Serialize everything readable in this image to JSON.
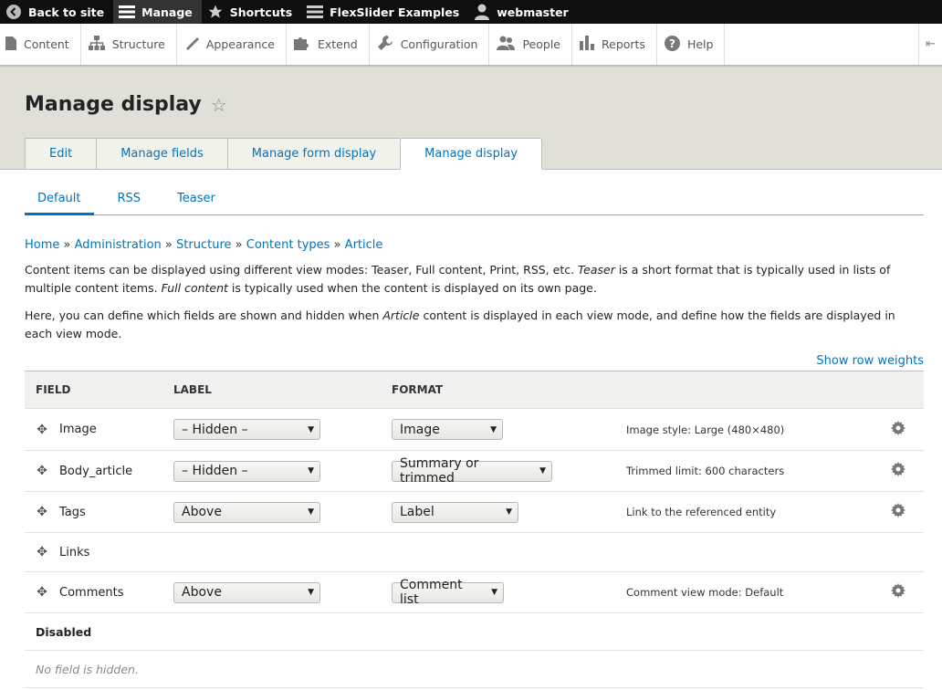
{
  "toolbar": {
    "back": "Back to site",
    "manage": "Manage",
    "shortcuts": "Shortcuts",
    "flexslider": "FlexSlider Examples",
    "user": "webmaster"
  },
  "tray": {
    "items": [
      "Content",
      "Structure",
      "Appearance",
      "Extend",
      "Configuration",
      "People",
      "Reports",
      "Help"
    ]
  },
  "page": {
    "title": "Manage display",
    "tabs": [
      "Edit",
      "Manage fields",
      "Manage form display",
      "Manage display"
    ],
    "subtabs": [
      "Default",
      "RSS",
      "Teaser"
    ]
  },
  "breadcrumb": {
    "home": "Home",
    "administration": "Administration",
    "structure": "Structure",
    "content_types": "Content types",
    "article": "Article",
    "separator": "»"
  },
  "help": {
    "p1_a": "Content items can be displayed using different view modes: Teaser, Full content, Print, RSS, etc. ",
    "p1_teaser": "Teaser",
    "p1_b": " is a short format that is typically used in lists of multiple content items. ",
    "p1_full": "Full content",
    "p1_c": " is typically used when the content is displayed on its own page.",
    "p2_a": "Here, you can define which fields are shown and hidden when ",
    "p2_article": "Article",
    "p2_b": " content is displayed in each view mode, and define how the fields are displayed in each view mode."
  },
  "show_weights": "Show row weights",
  "table": {
    "headers": [
      "FIELD",
      "LABEL",
      "FORMAT"
    ],
    "rows": [
      {
        "field": "Image",
        "label": "– Hidden –",
        "format": "Image",
        "summary": "Image style: Large (480×480)"
      },
      {
        "field": "Body_article",
        "label": "– Hidden –",
        "format": "Summary or trimmed",
        "summary": "Trimmed limit: 600 characters"
      },
      {
        "field": "Tags",
        "label": "Above",
        "format": "Label",
        "summary": "Link to the referenced entity"
      },
      {
        "field": "Links",
        "label": "",
        "format": "",
        "summary": ""
      },
      {
        "field": "Comments",
        "label": "Above",
        "format": "Comment list",
        "summary": "Comment view mode: Default"
      }
    ],
    "disabled_title": "Disabled",
    "disabled_empty": "No field is hidden."
  }
}
